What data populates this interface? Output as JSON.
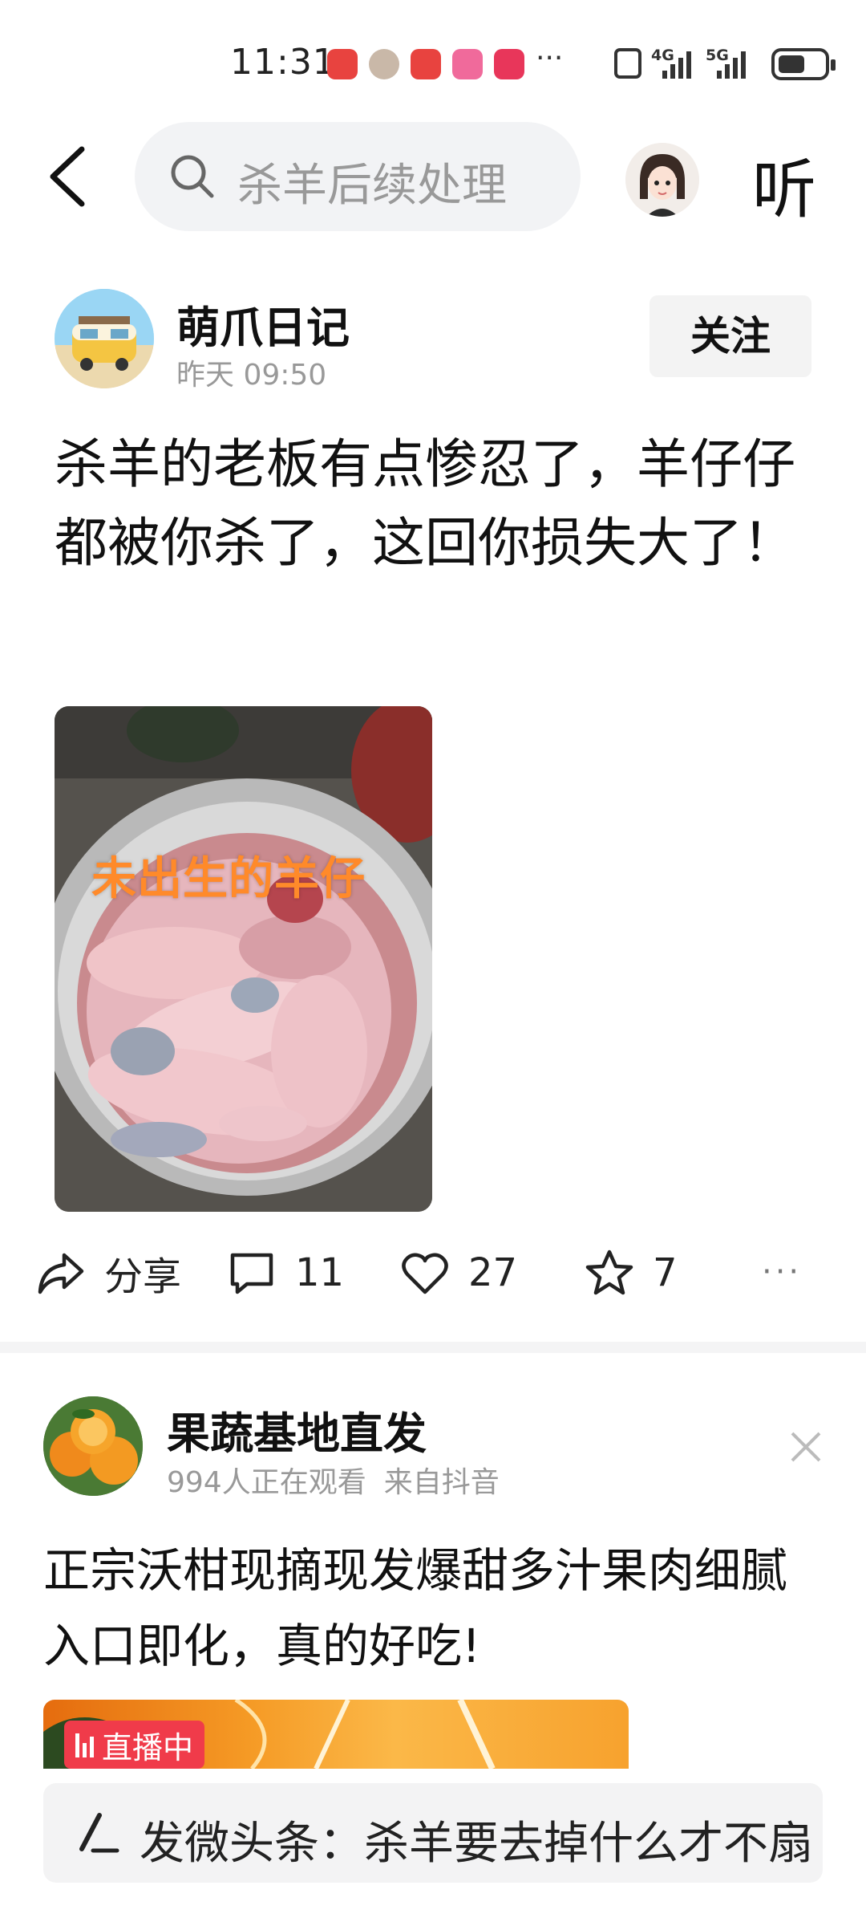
{
  "status_bar": {
    "time": "11:31",
    "more": "···",
    "network_1": "4G",
    "network_2": "5G"
  },
  "header": {
    "back_icon": "chevron-left-icon",
    "search_placeholder": "杀羊后续处理",
    "listen_label": "听"
  },
  "post1": {
    "username": "萌爪日记",
    "time": "昨天  09:50",
    "follow_label": "关注",
    "text": "杀羊的老板有点惨忍了，羊仔仔都被你杀了，这回你损失大了！",
    "image_caption": "未出生的羊仔",
    "actions": {
      "share_label": "分享",
      "comment_count": "11",
      "like_count": "27",
      "favorite_count": "7",
      "more_label": "···"
    }
  },
  "post2": {
    "username": "果蔬基地直发",
    "viewers": "994人正在观看",
    "source": "来自抖音",
    "text": "正宗沃柑现摘现发爆甜多汁果肉细腻入口即化，真的好吃!",
    "live_badge": "直播中"
  },
  "compose": {
    "text": "发微头条：杀羊要去掉什么才不扇"
  },
  "colors": {
    "accent_orange": "#ff8a2a",
    "live_red": "#f03b4a",
    "muted_text": "#999999"
  }
}
